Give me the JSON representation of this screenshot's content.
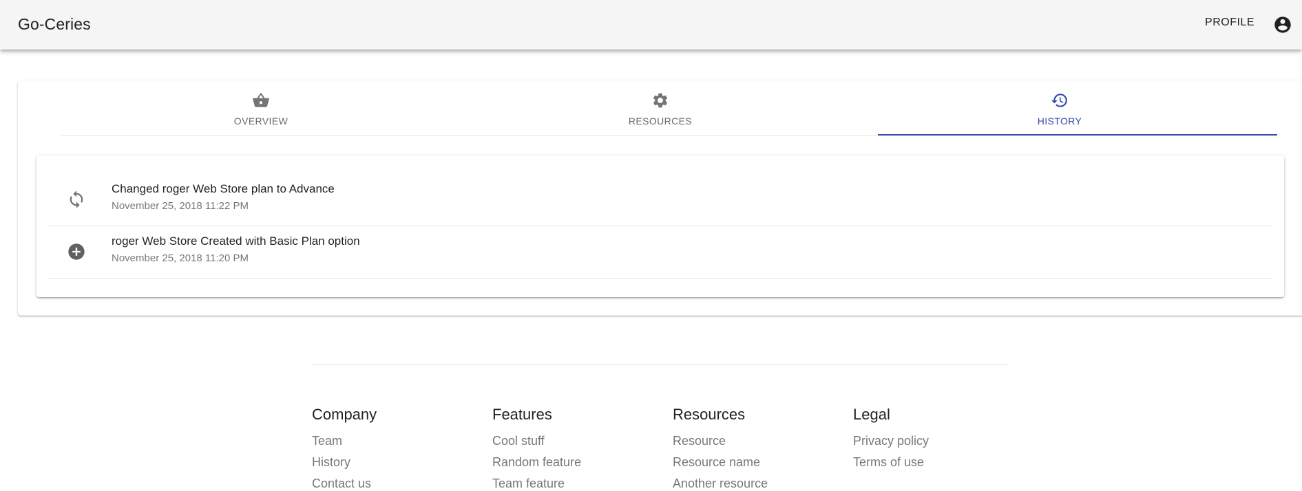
{
  "header": {
    "brand": "Go-Ceries",
    "profile_label": "PROFILE",
    "account_icon": "account-circle-icon"
  },
  "tabs": [
    {
      "label": "OVERVIEW",
      "icon": "shopping-basket-icon",
      "active": false
    },
    {
      "label": "RESOURCES",
      "icon": "gear-icon",
      "active": false
    },
    {
      "label": "HISTORY",
      "icon": "history-icon",
      "active": true
    }
  ],
  "history": {
    "items": [
      {
        "title": "Changed roger Web Store plan to Advance",
        "date": "November 25, 2018 11:22 PM",
        "icon": "sync-icon"
      },
      {
        "title": "roger Web Store Created with Basic Plan option",
        "date": "November 25, 2018 11:20 PM",
        "icon": "add-circle-icon"
      }
    ]
  },
  "footer": {
    "columns": [
      {
        "title": "Company",
        "links": [
          "Team",
          "History",
          "Contact us"
        ]
      },
      {
        "title": "Features",
        "links": [
          "Cool stuff",
          "Random feature",
          "Team feature"
        ]
      },
      {
        "title": "Resources",
        "links": [
          "Resource",
          "Resource name",
          "Another resource"
        ]
      },
      {
        "title": "Legal",
        "links": [
          "Privacy policy",
          "Terms of use"
        ]
      }
    ]
  },
  "colors": {
    "appbar_bg": "#f5f5f5",
    "accent": "#3949ab",
    "icon_gray": "#757575"
  }
}
